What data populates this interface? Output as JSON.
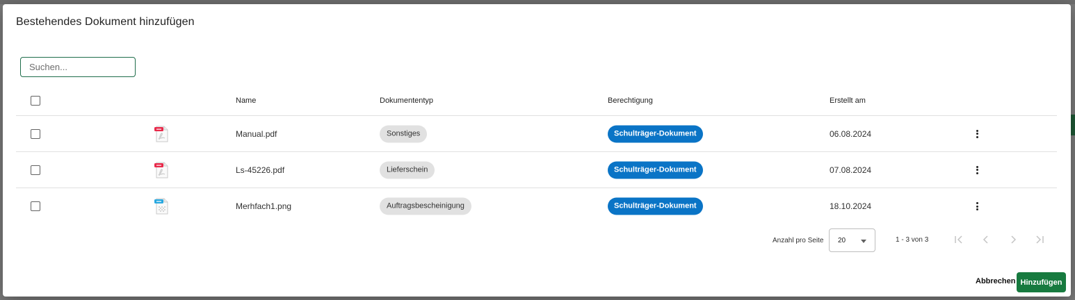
{
  "dialog": {
    "title": "Bestehendes Dokument hinzufügen"
  },
  "search": {
    "placeholder": "Suchen...",
    "value": ""
  },
  "table": {
    "columns": {
      "name": "Name",
      "type": "Dokumententyp",
      "permission": "Berechtigung",
      "created": "Erstellt am"
    },
    "rows": [
      {
        "file_icon": "pdf-file-icon",
        "name": "Manual.pdf",
        "type": "Sonstiges",
        "permission": "Schulträger-Dokument",
        "created": "06.08.2024",
        "checked": false
      },
      {
        "file_icon": "pdf-file-icon",
        "name": "Ls-45226.pdf",
        "type": "Lieferschein",
        "permission": "Schulträger-Dokument",
        "created": "07.08.2024",
        "checked": false
      },
      {
        "file_icon": "png-file-icon",
        "name": "Merhfach1.png",
        "type": "Auftragsbescheinigung",
        "permission": "Schulträger-Dokument",
        "created": "18.10.2024",
        "checked": false
      }
    ]
  },
  "pagination": {
    "per_page_label": "Anzahl pro Seite",
    "per_page_value": "20",
    "range_text": "1 - 3 von 3"
  },
  "actions": {
    "cancel_label": "Abbrechen",
    "add_label": "Hinzufügen"
  },
  "colors": {
    "accent_green": "#177a3f",
    "permission_chip_blue": "#0a74c6",
    "type_chip_grey": "#e1e1e1",
    "pdf_badge": "#e8294a",
    "png_badge": "#29a8e0"
  }
}
